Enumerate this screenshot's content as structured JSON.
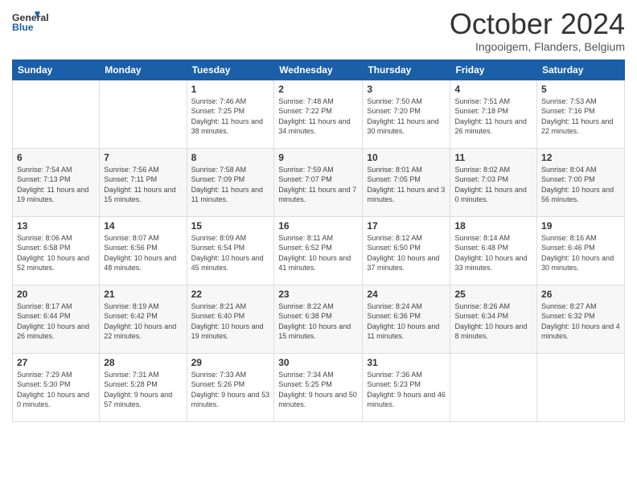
{
  "header": {
    "logo_line1": "General",
    "logo_line2": "Blue",
    "month_title": "October 2024",
    "location": "Ingooigem, Flanders, Belgium"
  },
  "days_of_week": [
    "Sunday",
    "Monday",
    "Tuesday",
    "Wednesday",
    "Thursday",
    "Friday",
    "Saturday"
  ],
  "weeks": [
    [
      {
        "day": "",
        "info": ""
      },
      {
        "day": "",
        "info": ""
      },
      {
        "day": "1",
        "info": "Sunrise: 7:46 AM\nSunset: 7:25 PM\nDaylight: 11 hours and 38 minutes."
      },
      {
        "day": "2",
        "info": "Sunrise: 7:48 AM\nSunset: 7:22 PM\nDaylight: 11 hours and 34 minutes."
      },
      {
        "day": "3",
        "info": "Sunrise: 7:50 AM\nSunset: 7:20 PM\nDaylight: 11 hours and 30 minutes."
      },
      {
        "day": "4",
        "info": "Sunrise: 7:51 AM\nSunset: 7:18 PM\nDaylight: 11 hours and 26 minutes."
      },
      {
        "day": "5",
        "info": "Sunrise: 7:53 AM\nSunset: 7:16 PM\nDaylight: 11 hours and 22 minutes."
      }
    ],
    [
      {
        "day": "6",
        "info": "Sunrise: 7:54 AM\nSunset: 7:13 PM\nDaylight: 11 hours and 19 minutes."
      },
      {
        "day": "7",
        "info": "Sunrise: 7:56 AM\nSunset: 7:11 PM\nDaylight: 11 hours and 15 minutes."
      },
      {
        "day": "8",
        "info": "Sunrise: 7:58 AM\nSunset: 7:09 PM\nDaylight: 11 hours and 11 minutes."
      },
      {
        "day": "9",
        "info": "Sunrise: 7:59 AM\nSunset: 7:07 PM\nDaylight: 11 hours and 7 minutes."
      },
      {
        "day": "10",
        "info": "Sunrise: 8:01 AM\nSunset: 7:05 PM\nDaylight: 11 hours and 3 minutes."
      },
      {
        "day": "11",
        "info": "Sunrise: 8:02 AM\nSunset: 7:03 PM\nDaylight: 11 hours and 0 minutes."
      },
      {
        "day": "12",
        "info": "Sunrise: 8:04 AM\nSunset: 7:00 PM\nDaylight: 10 hours and 56 minutes."
      }
    ],
    [
      {
        "day": "13",
        "info": "Sunrise: 8:06 AM\nSunset: 6:58 PM\nDaylight: 10 hours and 52 minutes."
      },
      {
        "day": "14",
        "info": "Sunrise: 8:07 AM\nSunset: 6:56 PM\nDaylight: 10 hours and 48 minutes."
      },
      {
        "day": "15",
        "info": "Sunrise: 8:09 AM\nSunset: 6:54 PM\nDaylight: 10 hours and 45 minutes."
      },
      {
        "day": "16",
        "info": "Sunrise: 8:11 AM\nSunset: 6:52 PM\nDaylight: 10 hours and 41 minutes."
      },
      {
        "day": "17",
        "info": "Sunrise: 8:12 AM\nSunset: 6:50 PM\nDaylight: 10 hours and 37 minutes."
      },
      {
        "day": "18",
        "info": "Sunrise: 8:14 AM\nSunset: 6:48 PM\nDaylight: 10 hours and 33 minutes."
      },
      {
        "day": "19",
        "info": "Sunrise: 8:16 AM\nSunset: 6:46 PM\nDaylight: 10 hours and 30 minutes."
      }
    ],
    [
      {
        "day": "20",
        "info": "Sunrise: 8:17 AM\nSunset: 6:44 PM\nDaylight: 10 hours and 26 minutes."
      },
      {
        "day": "21",
        "info": "Sunrise: 8:19 AM\nSunset: 6:42 PM\nDaylight: 10 hours and 22 minutes."
      },
      {
        "day": "22",
        "info": "Sunrise: 8:21 AM\nSunset: 6:40 PM\nDaylight: 10 hours and 19 minutes."
      },
      {
        "day": "23",
        "info": "Sunrise: 8:22 AM\nSunset: 6:38 PM\nDaylight: 10 hours and 15 minutes."
      },
      {
        "day": "24",
        "info": "Sunrise: 8:24 AM\nSunset: 6:36 PM\nDaylight: 10 hours and 11 minutes."
      },
      {
        "day": "25",
        "info": "Sunrise: 8:26 AM\nSunset: 6:34 PM\nDaylight: 10 hours and 8 minutes."
      },
      {
        "day": "26",
        "info": "Sunrise: 8:27 AM\nSunset: 6:32 PM\nDaylight: 10 hours and 4 minutes."
      }
    ],
    [
      {
        "day": "27",
        "info": "Sunrise: 7:29 AM\nSunset: 5:30 PM\nDaylight: 10 hours and 0 minutes."
      },
      {
        "day": "28",
        "info": "Sunrise: 7:31 AM\nSunset: 5:28 PM\nDaylight: 9 hours and 57 minutes."
      },
      {
        "day": "29",
        "info": "Sunrise: 7:33 AM\nSunset: 5:26 PM\nDaylight: 9 hours and 53 minutes."
      },
      {
        "day": "30",
        "info": "Sunrise: 7:34 AM\nSunset: 5:25 PM\nDaylight: 9 hours and 50 minutes."
      },
      {
        "day": "31",
        "info": "Sunrise: 7:36 AM\nSunset: 5:23 PM\nDaylight: 9 hours and 46 minutes."
      },
      {
        "day": "",
        "info": ""
      },
      {
        "day": "",
        "info": ""
      }
    ]
  ]
}
